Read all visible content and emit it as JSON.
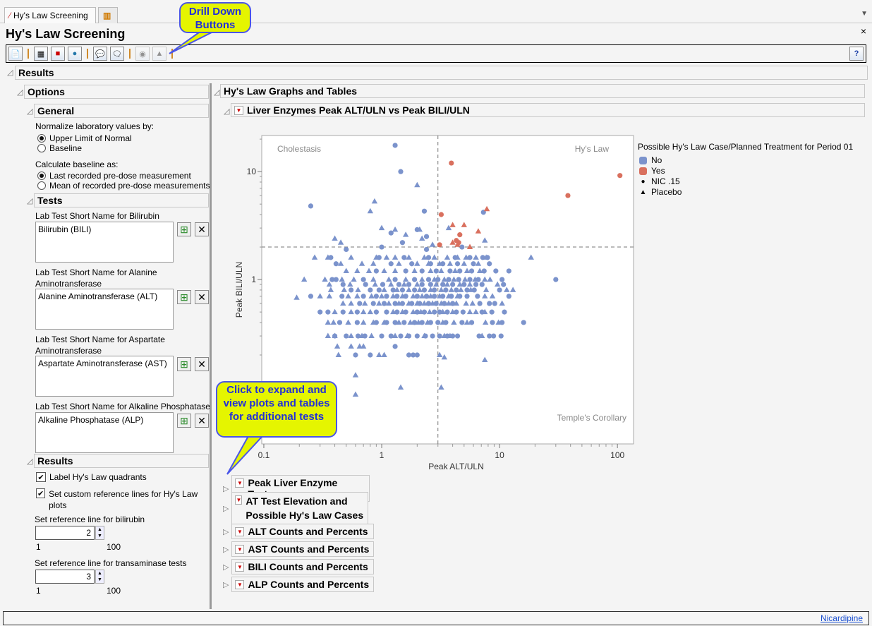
{
  "tabs": [
    {
      "label": "Hy's Law Screening"
    },
    {
      "label": ""
    }
  ],
  "window_title": "Hy's Law Screening",
  "toolbar": {
    "buttons": [
      "report-icon",
      "data-table-icon",
      "subset-icon",
      "web-report-icon",
      "add-note-icon",
      "view-notes-icon",
      "filter-globe-icon",
      "drill-icon"
    ],
    "help": "?"
  },
  "callouts": {
    "drill": "Drill Down Buttons",
    "expand": "Click to expand and view plots and tables for additional tests"
  },
  "results_header": "Results",
  "options": {
    "title": "Options",
    "general": {
      "title": "General",
      "normalize_label": "Normalize laboratory values by:",
      "normalize_options": [
        "Upper Limit of Normal",
        "Baseline"
      ],
      "normalize_selected": 0,
      "baseline_label": "Calculate baseline as:",
      "baseline_options": [
        "Last recorded pre-dose measurement",
        "Mean of recorded pre-dose measurements"
      ],
      "baseline_selected": 0
    },
    "tests": {
      "title": "Tests",
      "fields": [
        {
          "label": "Lab Test Short Name for Bilirubin",
          "value": "Bilirubin (BILI)"
        },
        {
          "label": "Lab Test Short Name for Alanine Aminotransferase",
          "value": "Alanine Aminotransferase (ALT)"
        },
        {
          "label": "Lab Test Short Name for Aspartate Aminotransferase",
          "value": "Aspartate Aminotransferase (AST)"
        },
        {
          "label": "Lab Test Short Name for Alkaline Phosphatase",
          "value": "Alkaline Phosphatase (ALP)"
        }
      ]
    },
    "results": {
      "title": "Results",
      "label_quadrants": "Label Hy's Law quadrants",
      "custom_ref": "Set custom reference lines for Hy's Law plots",
      "bili_label": "Set reference line for bilirubin",
      "bili_value": "2",
      "bili_min": "1",
      "bili_max": "100",
      "trans_label": "Set reference line for transaminase tests",
      "trans_value": "3",
      "trans_min": "1",
      "trans_max": "100"
    }
  },
  "graphs": {
    "title": "Hy's Law Graphs and Tables",
    "plot_title": "Liver Enzymes Peak ALT/ULN vs Peak BILI/ULN",
    "sections": [
      "Peak Liver Enzyme Tests",
      "AT Test Elevation and Possible Hy's Law Cases",
      "ALT Counts and Percents",
      "AST Counts and Percents",
      "BILI Counts and Percents",
      "ALP Counts and Percents"
    ]
  },
  "status": {
    "link": "Nicardipine"
  },
  "chart_data": {
    "type": "scatter",
    "xlabel": "Peak ALT/ULN",
    "ylabel": "Peak BILI/ULN",
    "xscale": "log",
    "yscale": "log",
    "xlim": [
      0.096,
      137
    ],
    "ylim": [
      0.03,
      21.6
    ],
    "xticks": [
      "0.1",
      "1",
      "10",
      "100"
    ],
    "yticks": [
      "1",
      "10"
    ],
    "ref_lines": {
      "x": 3,
      "y": 2
    },
    "quadrant_labels": [
      "Cholestasis",
      "Hy's Law",
      "Temple's Corollary"
    ],
    "legend": {
      "title": "Possible Hy's Law Case/Planned Treatment for Period 01",
      "entries": [
        {
          "label": "No",
          "color": "#7b93cc"
        },
        {
          "label": "Yes",
          "color": "#d9705e"
        },
        {
          "label": "NIC .15",
          "marker": "circle"
        },
        {
          "label": "Placebo",
          "marker": "triangle"
        }
      ]
    },
    "colors": {
      "No": "#7b93cc",
      "Yes": "#d9705e"
    },
    "points_yes": [
      [
        3.9,
        12,
        "c"
      ],
      [
        3.2,
        4,
        "c"
      ],
      [
        3.1,
        2.1,
        "c"
      ],
      [
        4.6,
        2.6,
        "c"
      ],
      [
        4.3,
        2.3,
        "c"
      ],
      [
        4.5,
        2.2,
        "c"
      ],
      [
        38,
        6,
        "c"
      ],
      [
        105,
        9.2,
        "c"
      ],
      [
        4,
        3.2,
        "t"
      ],
      [
        5,
        3.2,
        "t"
      ],
      [
        6.6,
        2.8,
        "t"
      ],
      [
        4,
        2.2,
        "t"
      ],
      [
        4.4,
        2.1,
        "t"
      ],
      [
        5.6,
        2,
        "t"
      ],
      [
        7.8,
        4.5,
        "t"
      ]
    ],
    "points_no": [
      [
        1.3,
        17.5,
        "c"
      ],
      [
        1.45,
        10,
        "c"
      ],
      [
        0.25,
        4.8,
        "c"
      ],
      [
        2.3,
        4.3,
        "c"
      ],
      [
        7.3,
        4.2,
        "c"
      ],
      [
        30,
        1,
        "c"
      ],
      [
        16,
        0.4,
        "c"
      ],
      [
        2,
        7.5,
        "t"
      ],
      [
        0.87,
        5.3,
        "t"
      ],
      [
        0.8,
        4.3,
        "t"
      ],
      [
        0.22,
        1,
        "t"
      ],
      [
        0.19,
        0.68,
        "t"
      ],
      [
        0.27,
        1.6,
        "t"
      ],
      [
        18.5,
        1.6,
        "t"
      ],
      [
        0.6,
        0.13,
        "t"
      ],
      [
        1.45,
        0.1,
        "t"
      ],
      [
        3.2,
        0.1,
        "t"
      ],
      [
        0.6,
        0.086,
        "t"
      ],
      [
        3.1,
        0.2,
        "t"
      ],
      [
        3.4,
        0.19,
        "t"
      ],
      [
        7.5,
        0.18,
        "t"
      ],
      [
        2.4,
        2.5,
        "c"
      ],
      [
        1.2,
        2.7,
        "c"
      ],
      [
        2,
        2.9,
        "c"
      ],
      [
        1.5,
        2.2,
        "c"
      ],
      [
        1,
        2,
        "c"
      ],
      [
        0.5,
        1.9,
        "c"
      ],
      [
        2.4,
        1.9,
        "c"
      ],
      [
        4.8,
        2,
        "c"
      ],
      [
        0.4,
        2.4,
        "t"
      ],
      [
        1,
        3,
        "t"
      ],
      [
        1.3,
        2.9,
        "t"
      ],
      [
        1.6,
        2.6,
        "t"
      ],
      [
        2.1,
        2.9,
        "t"
      ],
      [
        2.2,
        2.4,
        "t"
      ],
      [
        3.7,
        3,
        "t"
      ],
      [
        7.5,
        2.3,
        "t"
      ],
      [
        2.7,
        2.1,
        "t"
      ],
      [
        0.45,
        2.2,
        "t"
      ]
    ],
    "rows": [
      {
        "y": 1.6,
        "c": [
          0.37,
          0.95,
          1.55,
          2.5,
          4.2,
          5.6,
          7.2,
          7.9
        ],
        "t": [
          0.35,
          0.55,
          0.9,
          1.1,
          1.3,
          1.7,
          2.3,
          2.8,
          3.6,
          4.4,
          5.2,
          6.3,
          7.7
        ]
      },
      {
        "y": 1.4,
        "c": [
          0.41,
          1.2,
          1.8,
          2.6,
          3.3,
          4.4,
          6,
          8.2
        ],
        "t": [
          0.45,
          0.68,
          0.85,
          1.4,
          2,
          2.5,
          3.1,
          3.8,
          5,
          6.6
        ]
      },
      {
        "y": 1.2,
        "c": [
          0.9,
          1.6,
          2.2,
          2.9,
          3.8,
          4.6,
          5.8,
          7.4,
          9.3,
          12
        ],
        "t": [
          0.5,
          0.62,
          0.78,
          1.05,
          1.3,
          1.9,
          2.6,
          3.2,
          4.2,
          5.3,
          6.8
        ]
      },
      {
        "y": 1,
        "c": [
          0.38,
          0.41,
          0.7,
          1.3,
          1.9,
          2.5,
          3,
          3.7,
          4.5,
          5.6,
          6.6,
          10.5
        ],
        "t": [
          0.33,
          0.46,
          0.58,
          0.85,
          1.15,
          1.6,
          2.2,
          2.8,
          3.4,
          4.1,
          5.1,
          6.2,
          7.5,
          8.3
        ]
      },
      {
        "y": 0.9,
        "c": [
          0.47,
          0.73,
          1.02,
          1.4,
          1.7,
          2.2,
          2.6,
          3.3,
          4,
          5,
          6.3,
          7.1,
          10.8
        ],
        "t": [
          0.36,
          0.54,
          0.88,
          1.2,
          1.55,
          2,
          2.9,
          3.6,
          4.6,
          5.6,
          9.6
        ]
      },
      {
        "y": 0.8,
        "c": [
          0.55,
          0.8,
          0.95,
          1.25,
          1.5,
          1.9,
          2.3,
          2.8,
          3.5,
          4.3,
          5.3,
          6.1,
          10
        ],
        "t": [
          0.37,
          0.48,
          0.63,
          1.05,
          1.35,
          1.7,
          2.1,
          2.6,
          3.2,
          3.9,
          4.7,
          5.7,
          7.7,
          11.5,
          13
        ]
      },
      {
        "y": 0.7,
        "c": [
          0.25,
          0.46,
          0.7,
          0.9,
          1.1,
          1.35,
          1.6,
          2,
          2.4,
          2.8,
          3.3,
          3.9,
          4.6,
          5.3,
          6.5,
          12
        ],
        "t": [
          0.3,
          0.36,
          0.52,
          0.62,
          0.82,
          1,
          1.25,
          1.5,
          1.85,
          2.2,
          2.6,
          3.1,
          3.7,
          4.4,
          7.5,
          8.7
        ]
      },
      {
        "y": 0.6,
        "c": [
          0.65,
          0.85,
          1.05,
          1.3,
          1.5,
          1.8,
          2.1,
          2.5,
          2.9,
          3.4,
          4,
          6.8,
          8.2,
          9.1
        ],
        "t": [
          0.47,
          0.55,
          0.72,
          0.95,
          1.15,
          1.4,
          1.7,
          2,
          2.3,
          2.7,
          3.2,
          3.7,
          4.3,
          5.2,
          5.9,
          10.5
        ]
      },
      {
        "y": 0.5,
        "c": [
          0.3,
          0.35,
          0.47,
          0.62,
          0.9,
          1.1,
          1.35,
          1.6,
          2,
          2.3,
          2.8,
          3.1,
          3.6,
          4.3,
          4.9,
          7.1,
          8.6,
          11
        ],
        "t": [
          0.4,
          0.55,
          0.7,
          0.8,
          1.25,
          1.5,
          1.85,
          2.15,
          2.55,
          3.3,
          4,
          5.6,
          6.3,
          7.5
        ]
      },
      {
        "y": 0.4,
        "c": [
          0.44,
          0.62,
          0.9,
          1.1,
          1.3,
          1.55,
          1.9,
          2.2,
          2.6,
          3,
          3.5,
          4.8,
          5.8,
          8.7,
          10.5
        ],
        "t": [
          0.35,
          0.39,
          0.52,
          0.7,
          0.85,
          1.05,
          1.4,
          1.75,
          2.05,
          2.45,
          3.3,
          4.1,
          5.3,
          7.6,
          9.8
        ]
      },
      {
        "y": 0.3,
        "c": [
          0.4,
          0.5,
          0.63,
          0.72,
          1,
          1.2,
          1.45,
          1.7,
          2,
          2.35,
          2.7,
          3.1,
          3.6,
          4,
          4.4,
          6.7,
          8.2,
          8.9,
          10.3
        ],
        "t": [
          0.35,
          0.4,
          0.55,
          0.68,
          0.82,
          1.3,
          1.65,
          2.3,
          3.4,
          3.8,
          7.1
        ]
      },
      {
        "y": 0.24,
        "c": [
          1.3
        ],
        "t": [
          0.42,
          0.55,
          0.65,
          0.7
        ]
      },
      {
        "y": 0.2,
        "c": [
          0.6,
          0.8,
          1.7,
          1.85,
          2
        ],
        "t": [
          0.43,
          0.95,
          1.05
        ]
      }
    ]
  }
}
